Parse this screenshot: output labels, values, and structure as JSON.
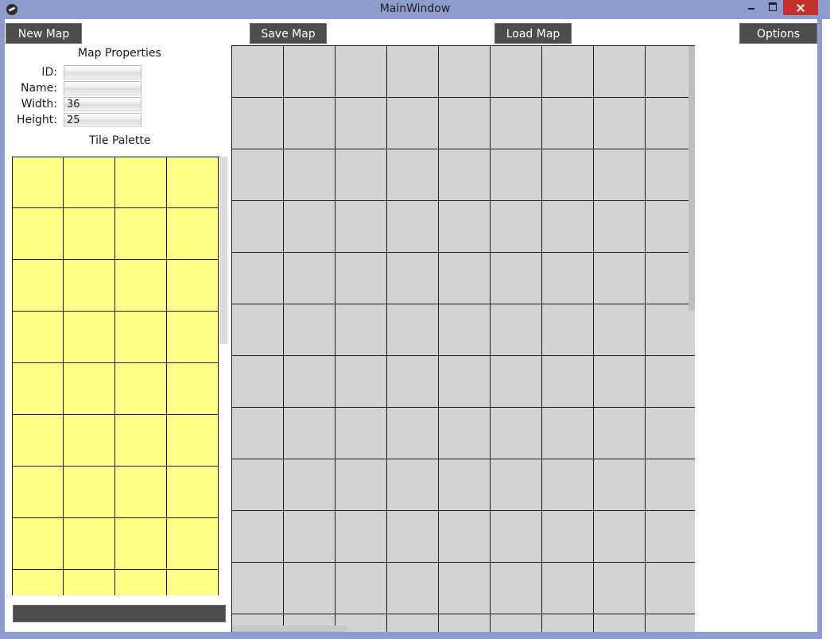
{
  "window": {
    "title": "MainWindow",
    "controls": {
      "minimize": "minimize-icon",
      "maximize": "maximize-icon",
      "close": "close-icon"
    },
    "app_icon": "app-icon"
  },
  "toolbar": {
    "new_map_label": "New Map",
    "save_map_label": "Save Map",
    "load_map_label": "Load Map",
    "options_label": "Options"
  },
  "map_properties": {
    "title": "Map Properties",
    "fields": {
      "id": {
        "label": "ID:",
        "value": ""
      },
      "name": {
        "label": "Name:",
        "value": ""
      },
      "width": {
        "label": "Width:",
        "value": "36"
      },
      "height": {
        "label": "Height:",
        "value": "25"
      }
    }
  },
  "tile_palette": {
    "title": "Tile Palette",
    "tile_color": "#ffff88"
  },
  "map_view": {
    "tile_color": "#d3d3d3"
  },
  "colors": {
    "titlebar": "#8d9ccd",
    "button_bg": "#4d4d4d",
    "close_button": "#c7302a"
  }
}
